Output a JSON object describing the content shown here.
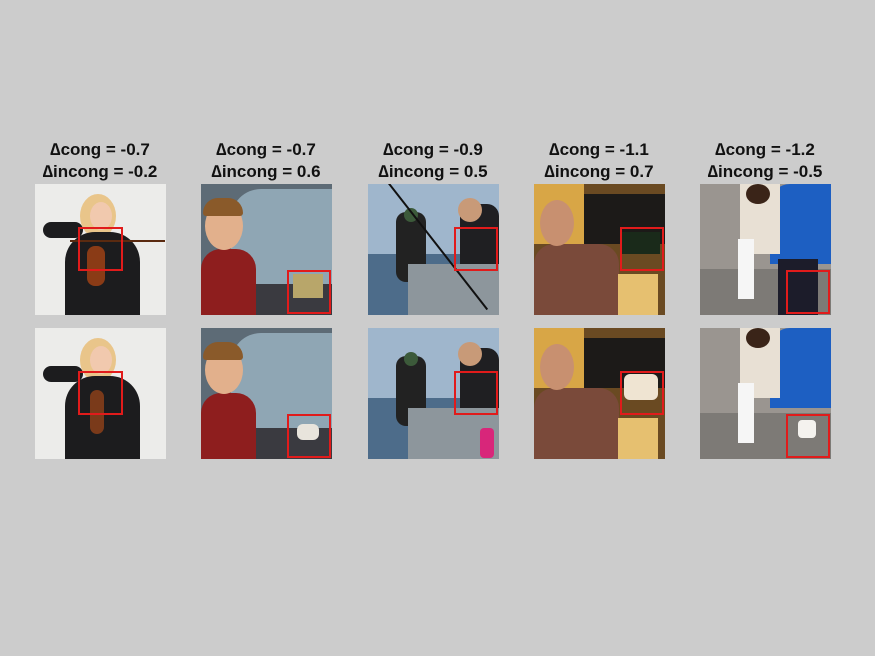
{
  "columns": [
    {
      "delta_symbol": "∆",
      "cong_text": "cong = -0.7",
      "incong_text": "incong = -0.2",
      "top_image": "woman playing violin (original)",
      "bottom_image": "woman playing violin (edited)"
    },
    {
      "delta_symbol": "∆",
      "cong_text": "cong = -0.7",
      "incong_text": "incong = 0.6",
      "top_image": "boy cleaning car window (original)",
      "bottom_image": "boy cleaning car window (edited)"
    },
    {
      "delta_symbol": "∆",
      "cong_text": "cong = -0.9",
      "incong_text": "incong = 0.5",
      "top_image": "men fishing on boat (original)",
      "bottom_image": "men fishing on boat (edited)"
    },
    {
      "delta_symbol": "∆",
      "cong_text": "cong = -1.1",
      "incong_text": "incong = 0.7",
      "top_image": "man pouring champagne (original)",
      "bottom_image": "man pouring champagne (edited)"
    },
    {
      "delta_symbol": "∆",
      "cong_text": "cong = -1.2",
      "incong_text": "incong = -0.5",
      "top_image": "people sitting on steps (original)",
      "bottom_image": "people sitting on steps (edited)"
    }
  ],
  "colors": {
    "background": "#cccccc",
    "bbox": "#e11b1b"
  }
}
